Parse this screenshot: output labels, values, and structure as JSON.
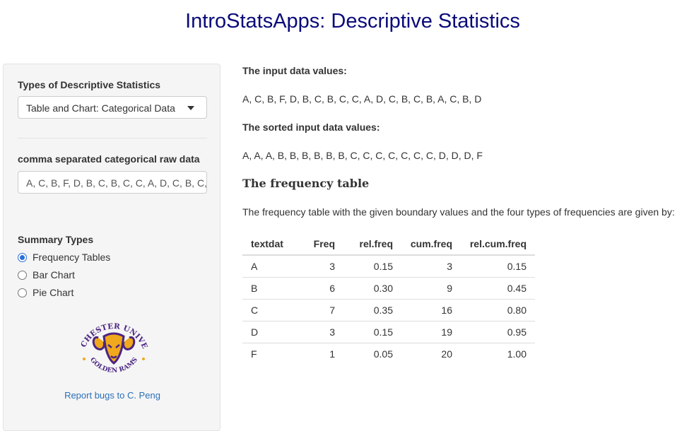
{
  "title": "IntroStatsApps: Descriptive Statistics",
  "sidebar": {
    "stat_type_label": "Types of Descriptive Statistics",
    "stat_type_selected": "Table and Chart: Categorical Data",
    "raw_data_label": "comma separated categorical raw data",
    "raw_data_value": "A, C, B, F, D, B, C, B, C, C, A, D, C, B, C, B, A, C, B, D",
    "summary_label": "Summary Types",
    "summary_options": [
      "Frequency Tables",
      "Bar Chart",
      "Pie Chart"
    ],
    "summary_selected": "Frequency Tables",
    "logo": {
      "top_text": "WEST CHESTER UNIVERSITY",
      "bottom_text": "GOLDEN RAMS",
      "colors": {
        "purple": "#4b2582",
        "gold": "#f0a81c"
      }
    },
    "bug_link": "Report bugs to C. Peng"
  },
  "main": {
    "input_heading": "The input data values:",
    "input_values": "A, C, B, F, D, B, C, B, C, C, A, D, C, B, C, B, A, C, B, D",
    "sorted_heading": "The sorted input data values:",
    "sorted_values": "A, A, A, B, B, B, B, B, B, C, C, C, C, C, C, C, D, D, D, F",
    "table_heading": "The frequency table",
    "table_description": "The frequency table with the given boundary values and the four types of frequencies are given by:",
    "table": {
      "columns": [
        "textdat",
        "Freq",
        "rel.freq",
        "cum.freq",
        "rel.cum.freq"
      ],
      "rows": [
        [
          "A",
          "3",
          "0.15",
          "3",
          "0.15"
        ],
        [
          "B",
          "6",
          "0.30",
          "9",
          "0.45"
        ],
        [
          "C",
          "7",
          "0.35",
          "16",
          "0.80"
        ],
        [
          "D",
          "3",
          "0.15",
          "19",
          "0.95"
        ],
        [
          "F",
          "1",
          "0.05",
          "20",
          "1.00"
        ]
      ]
    }
  },
  "colors": {
    "title": "#0a0a7a",
    "radio_accent": "#2a6fd8",
    "link": "#2a70b8"
  }
}
